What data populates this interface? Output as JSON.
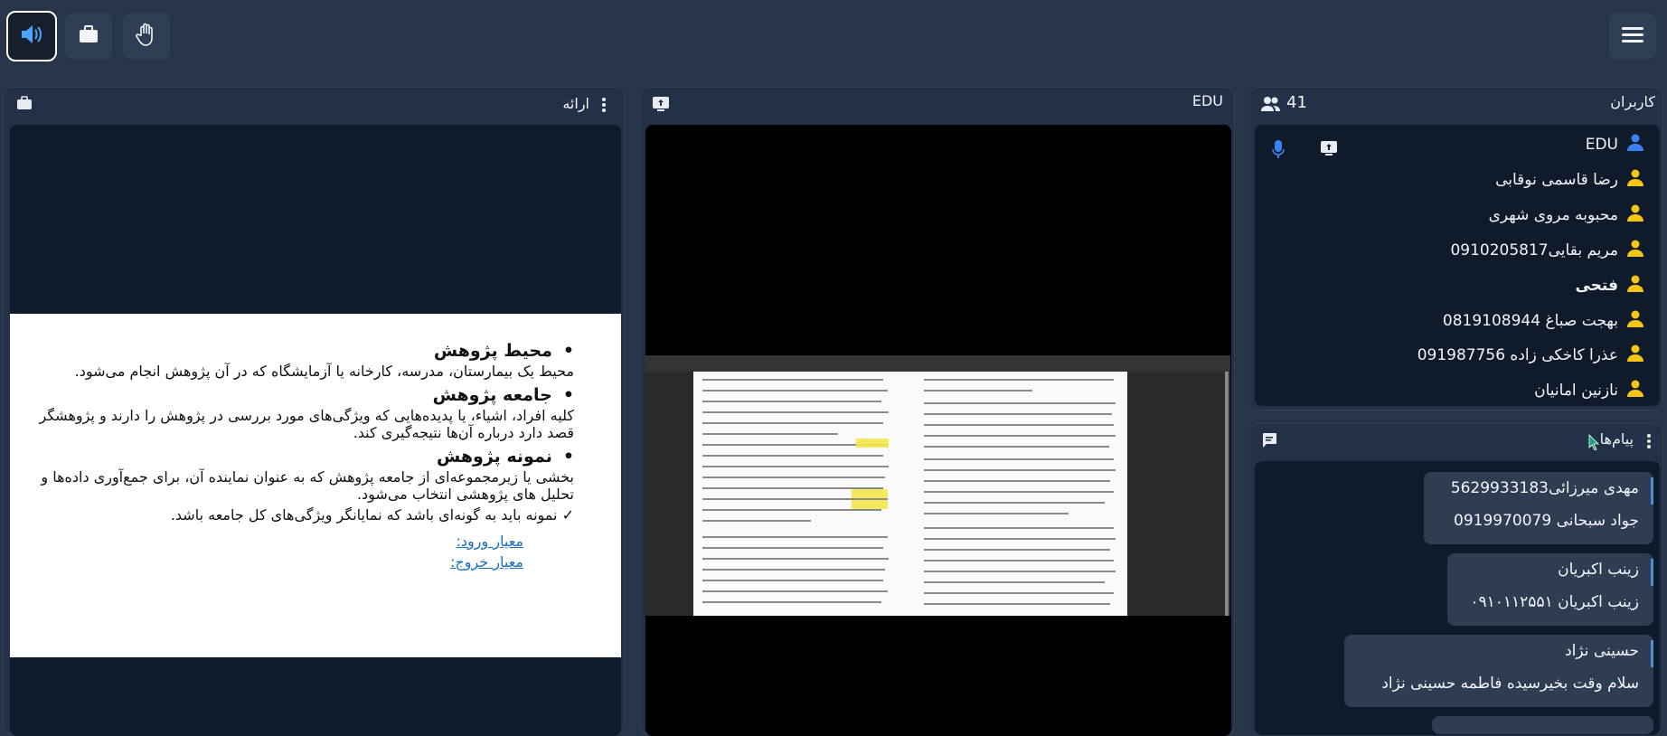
{
  "topbar": {
    "audio_button": "speaker",
    "share_button": "briefcase",
    "raise_hand_button": "hand",
    "menu_button": "menu"
  },
  "presentation": {
    "title": "ارائه"
  },
  "slide": {
    "heading1": "محیط پژوهش",
    "text1": "محیط یک بیمارستان، مدرسه، کارخانه یا آزمایشگاه که در آن پژوهش انجام می‌شود.",
    "heading2": "جامعه پژوهش",
    "text2": "کلیه افراد، اشیاء، یا پدیده‌هایی که ویژگی‌های مورد بررسی در پژوهش را دارند و پژوهشگر قصد دارد درباره آن‌ها نتیجه‌گیری کند.",
    "heading3": "نمونه پژوهش",
    "text3": "بخشی یا زیرمجموعه‌ای از جامعه پژوهش که به عنوان نماینده آن، برای جمع‌آوری داده‌ها و تحلیل های پژوهشی انتخاب می‌شود.",
    "check": "نمونه باید به گونه‌ای باشد که نمایانگر ویژگی‌های کل جامعه باشد.",
    "link1": "معیار ورود:",
    "link2": "معیار خروج:"
  },
  "video": {
    "title": "EDU"
  },
  "users": {
    "title": "کاربران",
    "count": "41",
    "list": [
      {
        "name": "EDU",
        "color": "#3b82f6"
      },
      {
        "name": "رضا قاسمی نوقابی",
        "color": "#f5c518"
      },
      {
        "name": "محبوبه مروی شهری",
        "color": "#f5c518"
      },
      {
        "name": "مریم بقایی0910205817",
        "color": "#f5c518"
      },
      {
        "name": "فتحی",
        "color": "#f5c518"
      },
      {
        "name": "بهجت صباغ 0819108944",
        "color": "#f5c518"
      },
      {
        "name": "عذرا کاخکی زاده 091987756",
        "color": "#f5c518"
      },
      {
        "name": "نازنین امانیان",
        "color": "#f5c518"
      }
    ]
  },
  "messages": {
    "title": "پیام‌ها",
    "items": [
      {
        "sender": "مهدی میرزائی5629933183",
        "text": "جواد سبحانی 0919970079"
      },
      {
        "sender": "زینب اکبریان",
        "text": "زینب اکبریان ۰۹۱۰۱۱۲۵۵۱"
      },
      {
        "sender": "حسینی نژاد",
        "text": "سلام وقت بخیرسیده فاطمه حسینی نژاد"
      }
    ]
  },
  "colors": {
    "accent": "#1f7fe6",
    "panel": "#223048",
    "background": "#263548"
  }
}
